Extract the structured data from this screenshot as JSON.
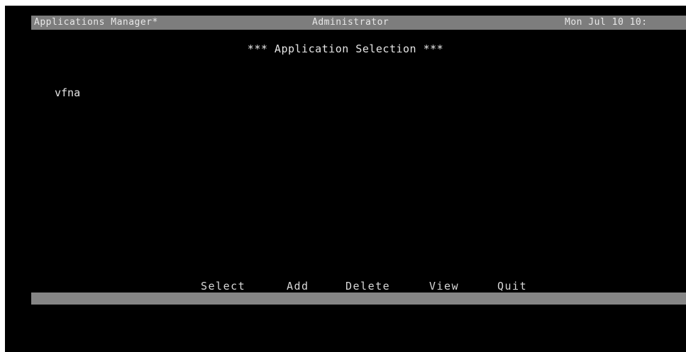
{
  "title_bar": {
    "app_title": "Applications Manager*",
    "user": "Administrator",
    "datetime": "Mon Jul 10 10:"
  },
  "screen": {
    "heading": "*** Application Selection ***"
  },
  "applications": [
    "vfna"
  ],
  "menu": {
    "select": "Select",
    "add": "Add",
    "delete": "Delete",
    "view": "View",
    "quit": "Quit"
  },
  "colors": {
    "background": "#000000",
    "bar": "#7d7d7d",
    "text": "#e6e6e6"
  }
}
